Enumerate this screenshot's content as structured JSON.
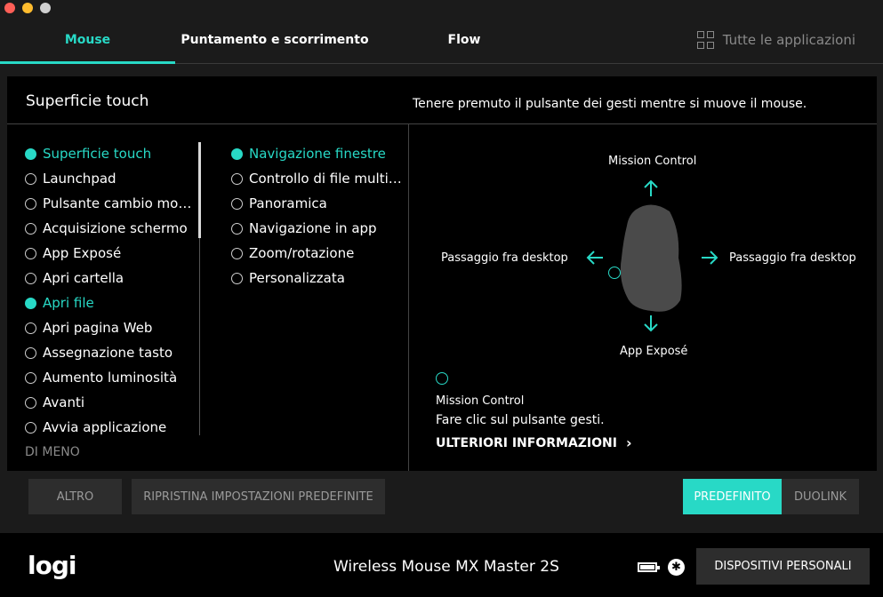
{
  "window": {
    "controls": [
      "close",
      "minimize",
      "zoom"
    ]
  },
  "tabs": [
    {
      "label": "Mouse",
      "active": true
    },
    {
      "label": "Puntamento e scorrimento",
      "active": false
    },
    {
      "label": "Flow",
      "active": false
    }
  ],
  "all_apps": {
    "label": "Tutte le applicazioni",
    "icon": "grid-icon"
  },
  "panel": {
    "title": "Superficie touch",
    "hint": "Tenere premuto il pulsante dei gesti mentre si muove il mouse."
  },
  "left_list": {
    "items": [
      {
        "label": "Superficie touch",
        "selected": true
      },
      {
        "label": "Launchpad",
        "selected": false
      },
      {
        "label": "Pulsante cambio modal...",
        "selected": false
      },
      {
        "label": "Acquisizione schermo",
        "selected": false
      },
      {
        "label": "App Exposé",
        "selected": false
      },
      {
        "label": "Apri cartella",
        "selected": false
      },
      {
        "label": "Apri file",
        "selected": true
      },
      {
        "label": "Apri pagina Web",
        "selected": false
      },
      {
        "label": "Assegnazione tasto",
        "selected": false
      },
      {
        "label": "Aumento luminosità",
        "selected": false
      },
      {
        "label": "Avanti",
        "selected": false
      },
      {
        "label": "Avvia applicazione",
        "selected": false
      }
    ],
    "more_label": "DI MENO"
  },
  "mid_list": {
    "items": [
      {
        "label": "Navigazione finestre",
        "selected": true
      },
      {
        "label": "Controllo di file multime...",
        "selected": false
      },
      {
        "label": "Panoramica",
        "selected": false
      },
      {
        "label": "Navigazione in app",
        "selected": false
      },
      {
        "label": "Zoom/rotazione",
        "selected": false
      },
      {
        "label": "Personalizzata",
        "selected": false
      }
    ]
  },
  "gesture": {
    "up": "Mission Control",
    "left": "Passaggio fra desktop",
    "right": "Passaggio fra desktop",
    "down": "App Exposé",
    "accent_color": "#28d9c6"
  },
  "info": {
    "title": "Mission Control",
    "description": "Fare clic sul pulsante gesti.",
    "link": "ULTERIORI INFORMAZIONI"
  },
  "buttons": {
    "altro": "ALTRO",
    "reset": "RIPRISTINA IMPOSTAZIONI PREDEFINITE",
    "default": "PREDEFINITO",
    "duolink": "DUOLINK"
  },
  "footer": {
    "logo": "logi",
    "device_name": "Wireless Mouse MX Master 2S",
    "devices_button": "DISPOSITIVI PERSONALI",
    "bt_symbol": "✱"
  }
}
